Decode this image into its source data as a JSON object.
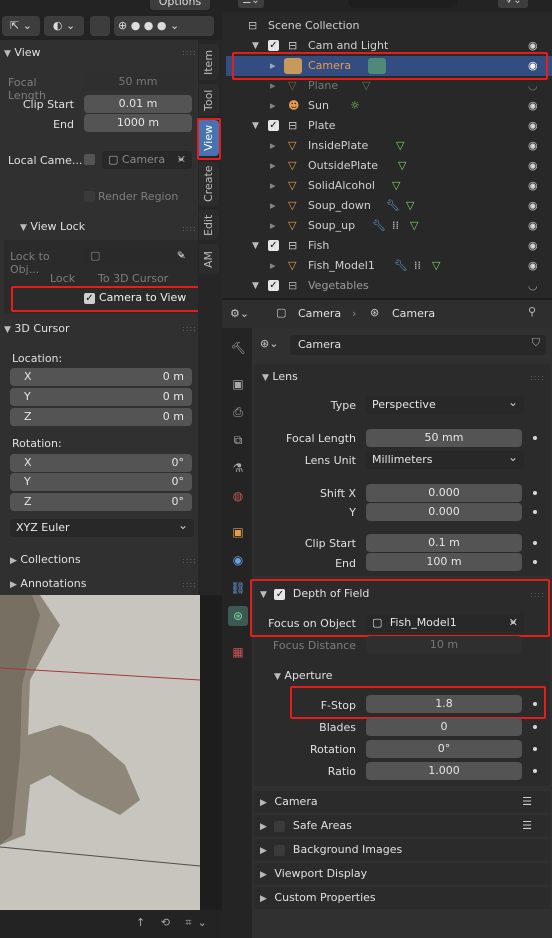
{
  "top_left_header": {
    "options_label": "Options"
  },
  "npanel": {
    "view_section": {
      "title": "View",
      "focal_length_label": "Focal Length",
      "focal_length_value": "50 mm",
      "clip_start_label": "Clip Start",
      "clip_start_value": "0.01 m",
      "clip_end_label": "End",
      "clip_end_value": "1000 m",
      "local_camera_label": "Local Came...",
      "local_camera_value": "Camera",
      "render_region_label": "Render Region"
    },
    "view_lock_section": {
      "title": "View Lock",
      "lock_to_object_label": "Lock to Obj...",
      "lock_label": "Lock",
      "to_3d_cursor_label": "To 3D Cursor",
      "camera_to_view_label": "Camera to View"
    },
    "cursor_section": {
      "title": "3D Cursor",
      "location_label": "Location:",
      "loc_x_label": "X",
      "loc_x_value": "0 m",
      "loc_y_label": "Y",
      "loc_y_value": "0 m",
      "loc_z_label": "Z",
      "loc_z_value": "0 m",
      "rotation_label": "Rotation:",
      "rot_x_label": "X",
      "rot_x_value": "0°",
      "rot_y_label": "Y",
      "rot_y_value": "0°",
      "rot_z_label": "Z",
      "rot_z_value": "0°",
      "rotation_mode": "XYZ Euler"
    },
    "collections_label": "Collections",
    "annotations_label": "Annotations",
    "tabs": [
      "Item",
      "Tool",
      "View",
      "Create",
      "Edit",
      "AM"
    ]
  },
  "outliner": {
    "scene_collection": "Scene Collection",
    "rows": [
      "Cam and Light",
      "Camera",
      "Plane",
      "Sun",
      "Plate",
      "InsidePlate",
      "OutsidePlate",
      "SolidAlcohol",
      "Soup_down",
      "Soup_up",
      "Fish",
      "Fish_Model1",
      "Vegetables"
    ]
  },
  "properties": {
    "header_object": "Camera",
    "header_data": "Camera",
    "datablock_name": "Camera",
    "lens": {
      "title": "Lens",
      "type_label": "Type",
      "type_value": "Perspective",
      "focal_length_label": "Focal Length",
      "focal_length_value": "50 mm",
      "lens_unit_label": "Lens Unit",
      "lens_unit_value": "Millimeters",
      "shift_x_label": "Shift X",
      "shift_x_value": "0.000",
      "shift_y_label": "Y",
      "shift_y_value": "0.000",
      "clip_start_label": "Clip Start",
      "clip_start_value": "0.1 m",
      "clip_end_label": "End",
      "clip_end_value": "100 m"
    },
    "dof": {
      "title": "Depth of Field",
      "focus_object_label": "Focus on Object",
      "focus_object_value": "Fish_Model1",
      "focus_distance_label": "Focus Distance",
      "focus_distance_value": "10 m"
    },
    "aperture": {
      "title": "Aperture",
      "fstop_label": "F-Stop",
      "fstop_value": "1.8",
      "blades_label": "Blades",
      "blades_value": "0",
      "rotation_label": "Rotation",
      "rotation_value": "0°",
      "ratio_label": "Ratio",
      "ratio_value": "1.000"
    },
    "collapsed": [
      "Camera",
      "Safe Areas",
      "Background Images",
      "Viewport Display",
      "Custom Properties"
    ]
  }
}
